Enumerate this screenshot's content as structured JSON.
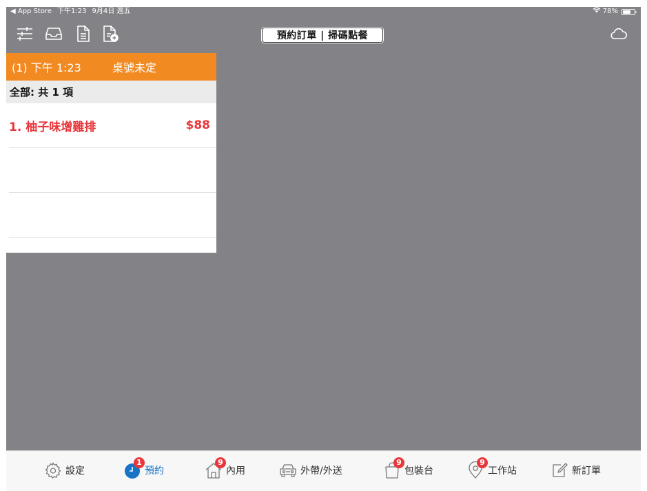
{
  "status_bar": {
    "back_app": "◀ App Store",
    "time": "下午1:23",
    "date": "9月4日 週五",
    "battery": "78%",
    "battery_level": 0.78
  },
  "toolbar": {
    "title": "預約訂單 | 掃碼點餐",
    "icons": [
      "sliders-icon",
      "tray-icon",
      "document-icon",
      "document-add-icon",
      "cloud-icon"
    ]
  },
  "order": {
    "header_time": "(1) 下午 1:23",
    "header_table": "桌號未定",
    "summary": "全部: 共 1 項",
    "items": [
      {
        "name": "1. 柚子味增雞排",
        "price": "$88"
      }
    ]
  },
  "tabs": [
    {
      "id": "settings",
      "label": "設定",
      "icon": "gear-icon",
      "badge": ""
    },
    {
      "id": "reservation",
      "label": "預約",
      "icon": "clock-icon",
      "badge": "1"
    },
    {
      "id": "dine-in",
      "label": "內用",
      "icon": "house-icon",
      "badge": "9"
    },
    {
      "id": "takeout",
      "label": "外帶/外送",
      "icon": "car-icon",
      "badge": ""
    },
    {
      "id": "packing",
      "label": "包裝台",
      "icon": "bag-icon",
      "badge": "9"
    },
    {
      "id": "workstation",
      "label": "工作站",
      "icon": "location-pin-icon",
      "badge": "9"
    },
    {
      "id": "new-order",
      "label": "新訂單",
      "icon": "compose-icon",
      "badge": ""
    }
  ],
  "colors": {
    "accent_orange": "#f28a22",
    "item_red": "#e8363a",
    "active_blue": "#1874c6",
    "badge_red": "#e8363a"
  }
}
